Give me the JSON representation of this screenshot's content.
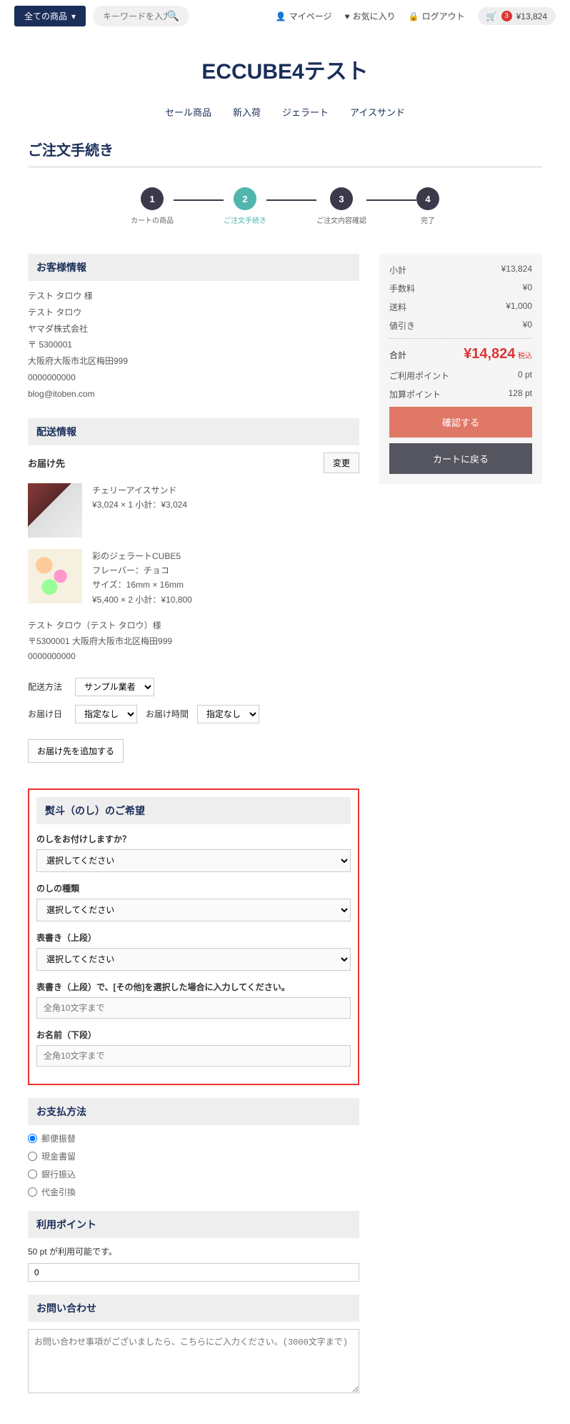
{
  "header": {
    "category": "全ての商品",
    "search_placeholder": "キーワードを入力",
    "mypage": "マイページ",
    "favorite": "お気に入り",
    "logout": "ログアウト",
    "cart_count": "3",
    "cart_total": "¥13,824"
  },
  "site_title": "ECCUBE4テスト",
  "nav": [
    "セール商品",
    "新入荷",
    "ジェラート",
    "アイスサンド"
  ],
  "page_title": "ご注文手続き",
  "steps": [
    {
      "num": "1",
      "label": "カートの商品"
    },
    {
      "num": "2",
      "label": "ご注文手続き"
    },
    {
      "num": "3",
      "label": "ご注文内容確認"
    },
    {
      "num": "4",
      "label": "完了"
    }
  ],
  "sections": {
    "customer": "お客様情報",
    "shipping": "配送情報",
    "noshi": "熨斗（のし）のご希望",
    "payment": "お支払方法",
    "points": "利用ポイント",
    "contact": "お問い合わせ"
  },
  "customer": {
    "name_kana": "テスト タロウ 様",
    "name": "テスト タロウ",
    "company": "ヤマダ株式会社",
    "zip": "〒 5300001",
    "address": "大阪府大阪市北区梅田999",
    "tel": "0000000000",
    "email": "blog@itoben.com"
  },
  "shipping": {
    "label": "お届け先",
    "change_btn": "変更",
    "products": [
      {
        "name": "チェリーアイスサンド",
        "line": "¥3,024 × 1  小計：¥3,024"
      },
      {
        "name": "彩のジェラートCUBE5",
        "flavor": "フレーバー：チョコ",
        "size": "サイズ：16mm × 16mm",
        "line": "¥5,400 × 2  小計：¥10,800"
      }
    ],
    "addr_name": "テスト タロウ（テスト タロウ）様",
    "addr_full": "〒5300001 大阪府大阪市北区梅田999",
    "addr_tel": "0000000000",
    "method_label": "配送方法",
    "method_value": "サンプル業者",
    "date_label": "お届け日",
    "date_value": "指定なし",
    "time_label": "お届け時間",
    "time_value": "指定なし",
    "add_btn": "お届け先を追加する"
  },
  "noshi": {
    "q1": "のしをお付けしますか？",
    "q2": "のしの種類",
    "q3": "表書き（上段）",
    "q4": "表書き（上段）で、[その他]を選択した場合に入力してください。",
    "q5": "お名前（下段）",
    "select_placeholder": "選択してください",
    "input4_placeholder": "全角10文字まで",
    "input5_placeholder": "全角10文字まで"
  },
  "payment_options": [
    "郵便振替",
    "現金書留",
    "銀行振込",
    "代金引換"
  ],
  "points": {
    "text": "50 pt が利用可能です。",
    "value": "0"
  },
  "contact_placeholder": "お問い合わせ事項がございましたら、こちらにご入力ください。(3000文字まで)",
  "summary": {
    "rows": [
      {
        "label": "小計",
        "value": "¥13,824"
      },
      {
        "label": "手数料",
        "value": "¥0"
      },
      {
        "label": "送料",
        "value": "¥1,000"
      },
      {
        "label": "値引き",
        "value": "¥0"
      }
    ],
    "total_label": "合計",
    "total_value": "¥14,824",
    "tax": "税込",
    "rows2": [
      {
        "label": "ご利用ポイント",
        "value": "0 pt"
      },
      {
        "label": "加算ポイント",
        "value": "128 pt"
      }
    ],
    "confirm": "確認する",
    "back": "カートに戻る"
  }
}
